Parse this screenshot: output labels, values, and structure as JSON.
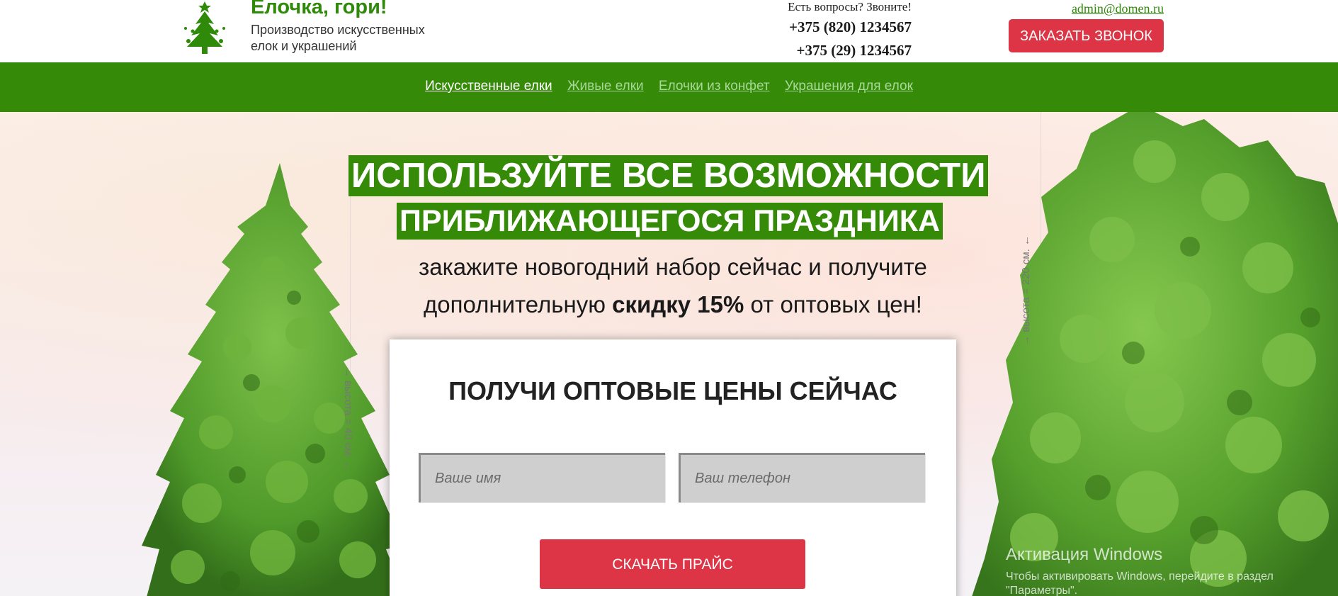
{
  "header": {
    "logo_title": "Елочка, гори!",
    "logo_subtitle": "Производство искусственных елок и украшений",
    "contact_question": "Есть вопросы? Звоните!",
    "phone_1": "+375 (820) 1234567",
    "phone_2": "+375 (29) 1234567",
    "email": "admin@domen.ru",
    "callback_label": "ЗАКАЗАТЬ ЗВОНОК"
  },
  "nav": {
    "items": [
      {
        "label": "Искусственные елки",
        "active": true
      },
      {
        "label": "Живые елки",
        "active": false
      },
      {
        "label": "Елочки из конфет",
        "active": false
      },
      {
        "label": "Украшения для елок",
        "active": false
      }
    ]
  },
  "hero": {
    "headline_1": "ИСПОЛЬЗУЙТЕ ВСЕ ВОЗМОЖНОСТИ",
    "headline_2": "ПРИБЛИЖАЮЩЕГОСЯ ПРАЗДНИКА",
    "subline_pre": "закажите новогодний набор сейчас и получите дополнительную",
    "subline_bold": "скидку 15%",
    "subline_post": "от оптовых цен!",
    "height_left": "→ высота = 40 см. ←",
    "height_right": "→ высота = 220 см. ←"
  },
  "form": {
    "title": "ПОЛУЧИ ОПТОВЫЕ ЦЕНЫ СЕЙЧАС",
    "name_placeholder": "Ваше имя",
    "phone_placeholder": "Ваш телефон",
    "download_label": "СКАЧАТЬ ПРАЙС"
  },
  "watermark": {
    "title": "Активация Windows",
    "subtitle_1": "Чтобы активировать Windows, перейдите в раздел",
    "subtitle_2": "\"Параметры\"."
  },
  "colors": {
    "brand_green": "#358a08",
    "accent_red": "#dd3545",
    "nav_inactive": "#a8d897"
  }
}
